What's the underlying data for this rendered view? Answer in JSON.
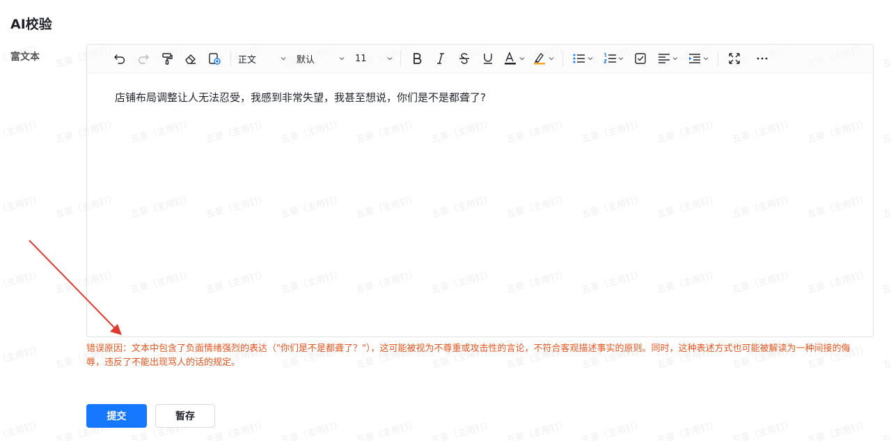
{
  "page": {
    "title": "AI校验",
    "watermark": "五豪（主用钉）"
  },
  "form": {
    "field_label": "富文本",
    "toolbar": {
      "paragraph_style": "正文",
      "font_family": "默认",
      "font_size": "11"
    },
    "content": "店铺布局调整让人无法忍受，我感到非常失望，我甚至想说，你们是不是都聋了?",
    "error_message": "错误原因：文本中包含了负面情绪强烈的表达（\"你们是不是都聋了？\"），这可能被视为不尊重或攻击性的言论，不符合客观描述事实的原则。同时，这种表述方式也可能被解读为一种间接的侮辱，违反了不能出现骂人的话的规定。"
  },
  "actions": {
    "submit_label": "提交",
    "save_label": "暂存"
  },
  "colors": {
    "primary": "#1677ff",
    "error": "#e8541e",
    "annotation_arrow": "#e03a2f",
    "highlight": "#f5a623"
  }
}
